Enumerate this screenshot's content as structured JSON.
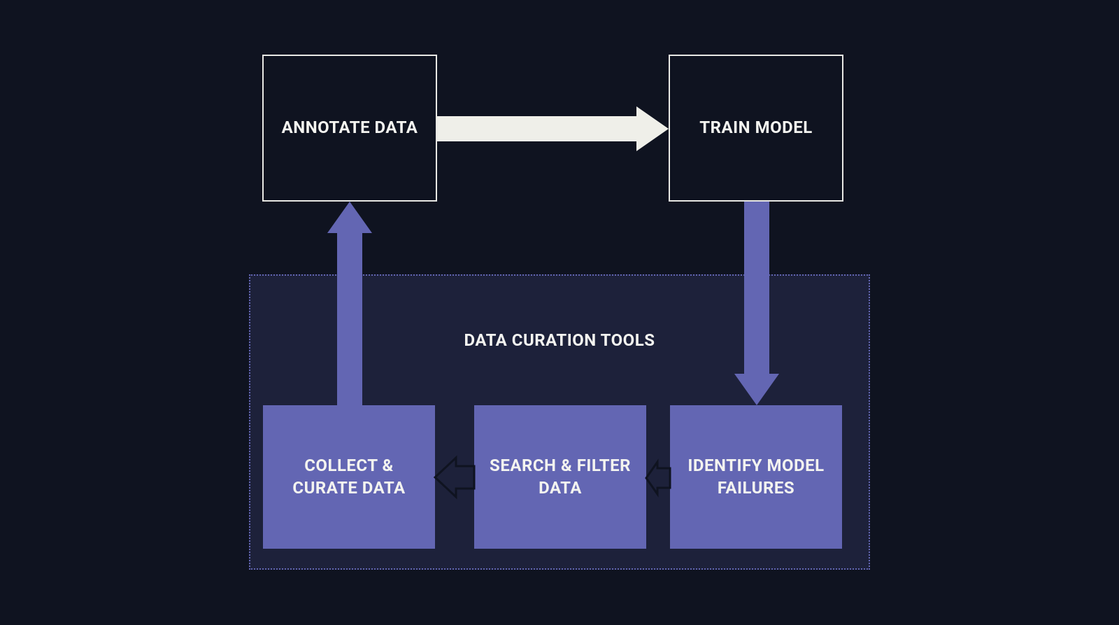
{
  "boxes": {
    "annotate": "ANNOTATE DATA",
    "train": "TRAIN MODEL",
    "collect": "COLLECT & CURATE DATA",
    "search": "SEARCH & FILTER DATA",
    "identify": "IDENTIFY MODEL FAILURES"
  },
  "container": {
    "title": "DATA CURATION TOOLS"
  },
  "colors": {
    "background": "#0f1320",
    "outline": "#e8e8e4",
    "purple_fill": "#6366b3",
    "purple_arrow": "#6366b3",
    "white_arrow": "#efefe9",
    "text": "#f4f4f0"
  },
  "diagram": {
    "type": "flow",
    "nodes": [
      {
        "id": "annotate",
        "label": "ANNOTATE DATA",
        "style": "outlined"
      },
      {
        "id": "train",
        "label": "TRAIN MODEL",
        "style": "outlined"
      },
      {
        "id": "identify",
        "label": "IDENTIFY MODEL FAILURES",
        "style": "filled",
        "group": "curation"
      },
      {
        "id": "search",
        "label": "SEARCH & FILTER DATA",
        "style": "filled",
        "group": "curation"
      },
      {
        "id": "collect",
        "label": "COLLECT & CURATE DATA",
        "style": "filled",
        "group": "curation"
      }
    ],
    "edges": [
      {
        "from": "annotate",
        "to": "train",
        "style": "solid-white"
      },
      {
        "from": "train",
        "to": "identify",
        "style": "solid-purple"
      },
      {
        "from": "identify",
        "to": "search",
        "style": "outline-dark"
      },
      {
        "from": "search",
        "to": "collect",
        "style": "outline-dark"
      },
      {
        "from": "collect",
        "to": "annotate",
        "style": "solid-purple"
      }
    ],
    "groups": [
      {
        "id": "curation",
        "label": "DATA CURATION TOOLS"
      }
    ]
  }
}
